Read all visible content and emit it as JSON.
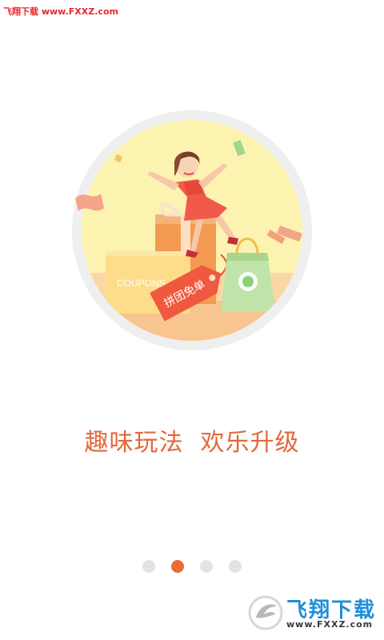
{
  "watermark": {
    "top_left": "飞翔下载 www.FXXZ.com"
  },
  "onboarding": {
    "slogan": "趣味玩法  欢乐升级",
    "illustration": {
      "coupon_text": "COUPONS",
      "tag_text": "拼团免单"
    },
    "pager": {
      "total": 4,
      "active_index": 1
    }
  },
  "brand_logo": {
    "name": "飞翔下载",
    "url": "www.FXXZ.com"
  },
  "colors": {
    "accent": "#ee6a35",
    "slogan": "#e2683a",
    "dot_inactive": "#e3e3e3",
    "circle_bg": "#fdf3b0"
  }
}
